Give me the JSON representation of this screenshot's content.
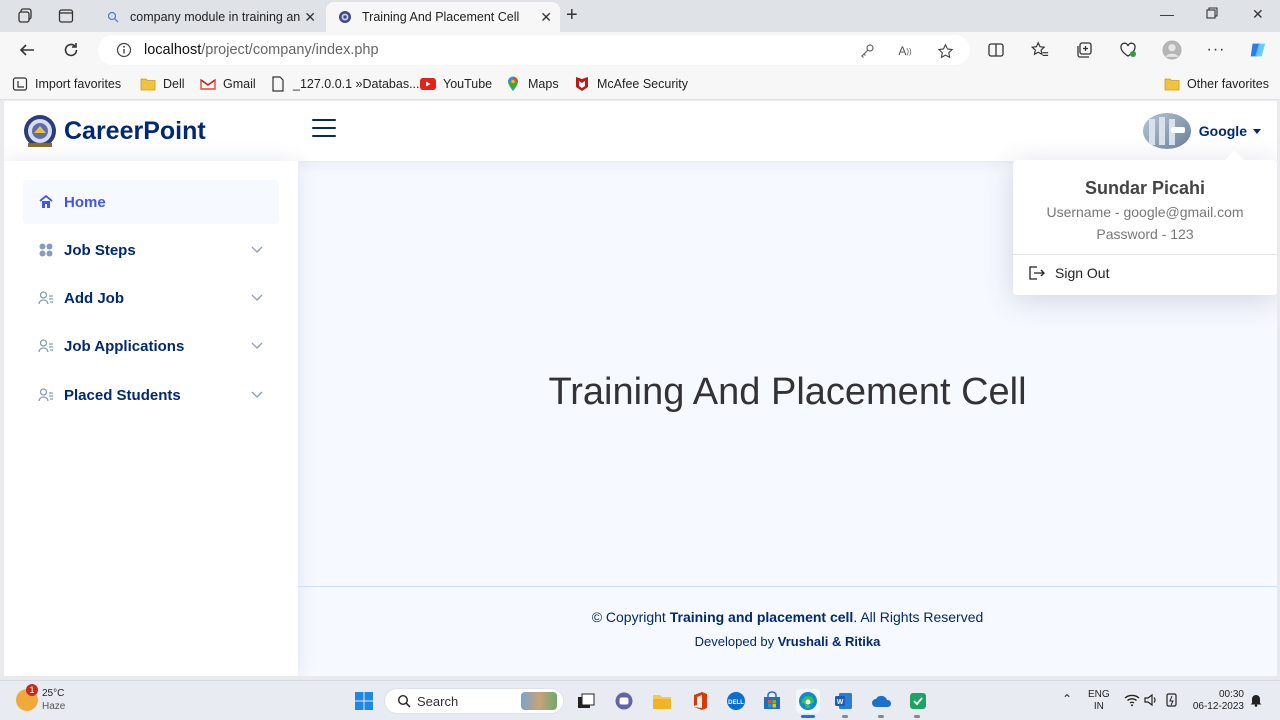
{
  "browser": {
    "tabs": [
      {
        "title": "company module in training and",
        "active": false
      },
      {
        "title": "Training And Placement Cell",
        "active": true
      }
    ],
    "address": {
      "host": "localhost",
      "path": "/project/company/index.php"
    },
    "bookmarks": [
      {
        "label": "Import favorites",
        "icon": "import-icon"
      },
      {
        "label": "Dell",
        "icon": "folder-icon"
      },
      {
        "label": "Gmail",
        "icon": "gmail-icon"
      },
      {
        "label": "_127.0.0.1 »Databas...",
        "icon": "page-icon"
      },
      {
        "label": "YouTube",
        "icon": "youtube-icon"
      },
      {
        "label": "Maps",
        "icon": "maps-icon"
      },
      {
        "label": "McAfee Security",
        "icon": "mcafee-icon"
      }
    ],
    "other_favorites": "Other favorites"
  },
  "header": {
    "logo_text": "CareerPoint",
    "profile_name": "Google"
  },
  "sidebar": {
    "items": [
      {
        "label": "Home",
        "icon": "home-icon",
        "active": true
      },
      {
        "label": "Job Steps",
        "icon": "grid-icon"
      },
      {
        "label": "Add Job",
        "icon": "person-lines-icon"
      },
      {
        "label": "Job Applications",
        "icon": "person-lines-icon"
      },
      {
        "label": "Placed Students",
        "icon": "person-lines-icon"
      }
    ]
  },
  "main": {
    "title": "Training And Placement Cell"
  },
  "dropdown": {
    "name": "Sundar Picahi",
    "username": "Username - google@gmail.com",
    "password": "Password - 123",
    "signout": "Sign Out"
  },
  "footer": {
    "copy_prefix": "© Copyright ",
    "copy_bold": "Training and placement cell",
    "copy_suffix": ". All Rights Reserved",
    "dev_prefix": "Developed by ",
    "dev_bold": "Vrushali & Ritika"
  },
  "taskbar": {
    "weather_temp": "25°C",
    "weather_desc": "Haze",
    "weather_badge": "1",
    "search_label": "Search",
    "lang_top": "ENG",
    "lang_bottom": "IN",
    "time": "00:30",
    "date": "06-12-2023"
  },
  "colors": {
    "brand": "#012970",
    "active_nav": "#4154f1",
    "page_bg": "#f6f9ff"
  }
}
